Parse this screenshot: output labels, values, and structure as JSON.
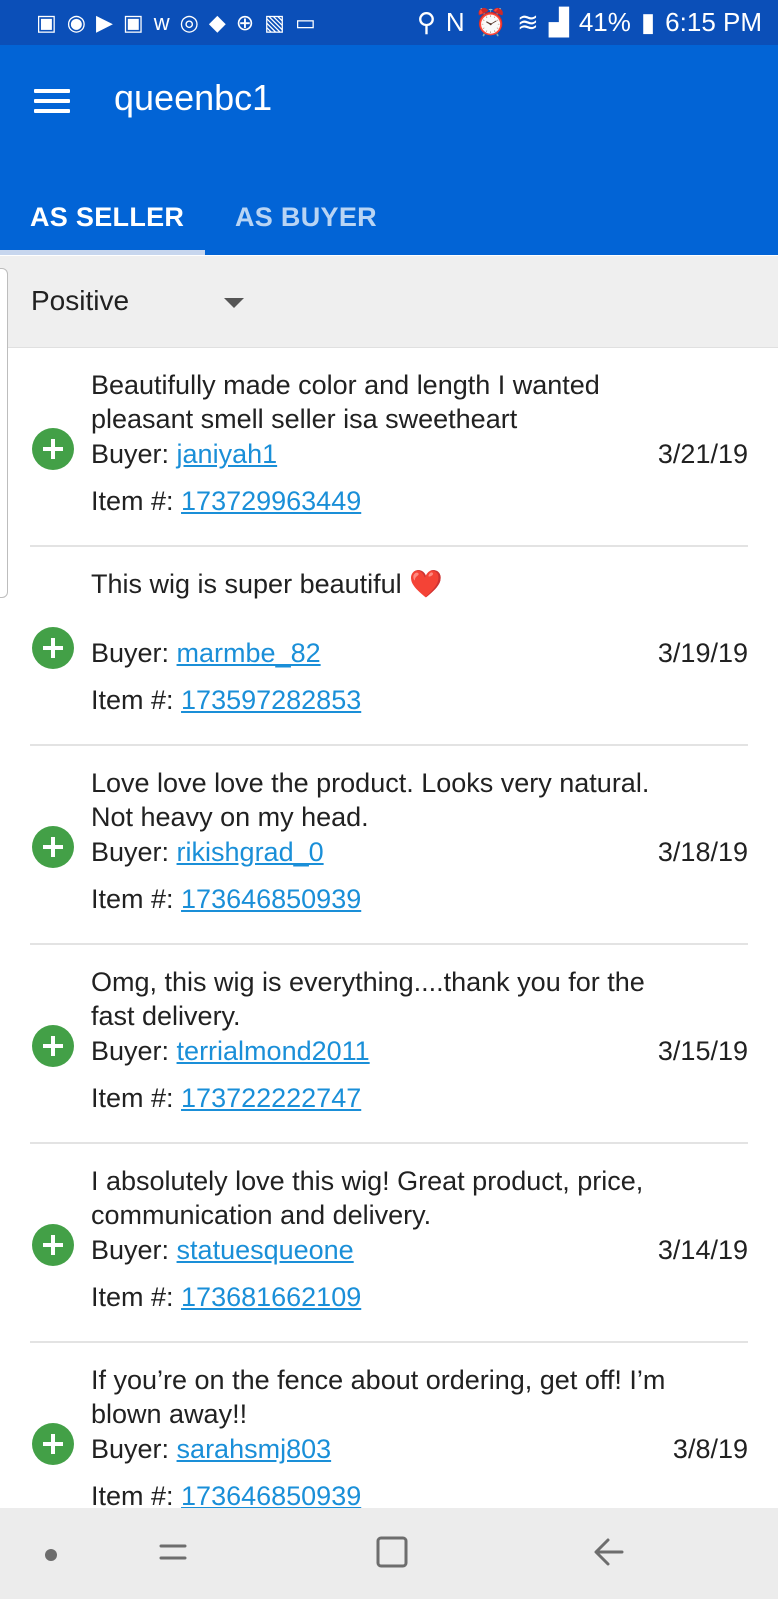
{
  "status_bar": {
    "battery": "41%",
    "time": "6:15 PM"
  },
  "app_bar": {
    "title": "queenbc1"
  },
  "tabs": [
    {
      "label": "AS SELLER"
    },
    {
      "label": "AS BUYER"
    }
  ],
  "filter": {
    "selected": "Positive"
  },
  "labels": {
    "buyer": "Buyer: ",
    "item": "Item #: "
  },
  "feedback": [
    {
      "comment": "Beautifully made color and length I wanted pleasant smell seller isa sweetheart",
      "buyer": "janiyah1",
      "date": "3/21/19",
      "item": "173729963449"
    },
    {
      "comment": "This wig is super beautiful",
      "emoji": "❤️",
      "buyer": "marmbe_82",
      "date": "3/19/19",
      "item": "173597282853"
    },
    {
      "comment": "Love love love the product. Looks very natural. Not heavy on my head.",
      "buyer": "rikishgrad_0",
      "date": "3/18/19",
      "item": "173646850939"
    },
    {
      "comment": "Omg, this wig is everything....thank you for the fast delivery.",
      "buyer": "terrialmond2011",
      "date": "3/15/19",
      "item": "173722222747"
    },
    {
      "comment": "I absolutely love this wig!  Great product, price, communication and delivery.",
      "buyer": "statuesqueone",
      "date": "3/14/19",
      "item": "173681662109"
    },
    {
      "comment": "If you’re on the fence about ordering, get off! I’m blown away!!",
      "buyer": "sarahsmj803",
      "date": "3/8/19",
      "item": "173646850939"
    }
  ],
  "colors": {
    "status_bar": "#0b4fb8",
    "app_bar": "#0264d6",
    "positive": "#43a047",
    "link": "#1a8fd8"
  }
}
